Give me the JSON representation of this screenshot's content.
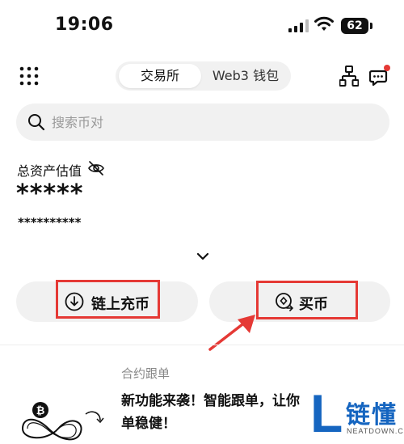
{
  "status_bar": {
    "time": "19:06",
    "battery": "62"
  },
  "header": {
    "tabs": [
      {
        "label": "交易所",
        "active": true
      },
      {
        "label": "Web3 钱包",
        "active": false
      }
    ]
  },
  "search": {
    "placeholder": "搜索币对"
  },
  "assets": {
    "label": "总资产估值",
    "value": "*****",
    "sub_value": "**********"
  },
  "actions": {
    "deposit_label": "链上充币",
    "buy_label": "买币"
  },
  "card": {
    "category": "合约跟单",
    "title_line1": "新功能来袭！智能跟单，让你",
    "title_line2": "单稳健！"
  },
  "watermark": {
    "cn": "链懂",
    "en": "NEATDOWN.COM"
  },
  "colors": {
    "highlight": "#e53935",
    "notification": "#e53935",
    "watermark": "#1565c0"
  }
}
